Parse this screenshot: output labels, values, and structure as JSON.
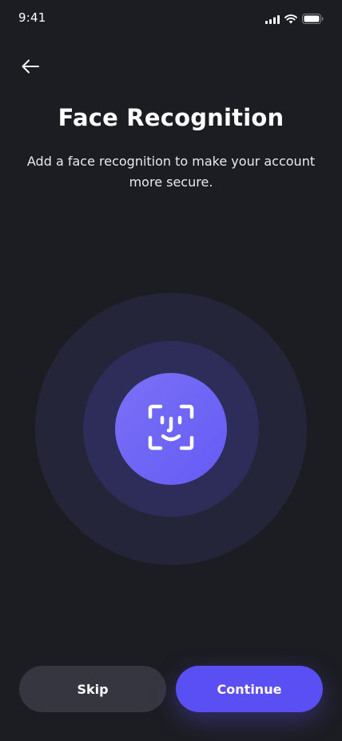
{
  "status_bar": {
    "time": "9:41",
    "signal_icon": "cellular-signal-icon",
    "wifi_icon": "wifi-icon",
    "battery_icon": "battery-icon"
  },
  "header": {
    "back_icon": "back-arrow-icon"
  },
  "main": {
    "title": "Face Recognition",
    "subtitle": "Add a face recognition to make your account more secure.",
    "face_icon": "face-id-icon"
  },
  "actions": {
    "skip_label": "Skip",
    "continue_label": "Continue"
  },
  "colors": {
    "background": "#1c1d22",
    "accent": "#5a4ff2",
    "skip_button": "#353640",
    "ring_outer": "#25253a",
    "ring_middle": "#2e2c58",
    "ring_inner": "#6f65f6"
  }
}
